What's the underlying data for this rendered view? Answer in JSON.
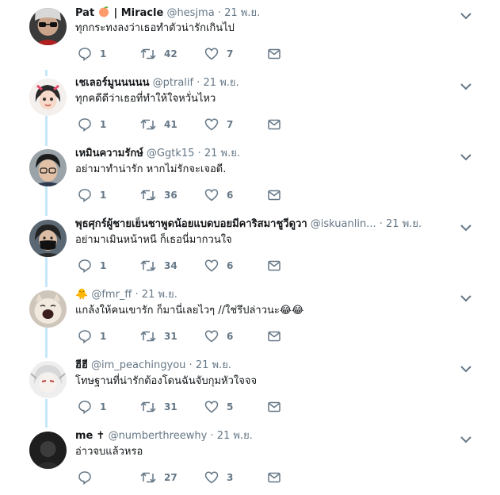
{
  "tweets": [
    {
      "name": "Pat",
      "name_extra": "| Miracle",
      "handle": "@hesjma",
      "dot": "·",
      "time": "21 พ.ย.",
      "text": "ทุกกระทงลงว่าเธอทำตัวน่ารักเกินไป",
      "replies": "1",
      "retweets": "42",
      "likes": "7",
      "avatar_icon": "avatar-sunglasses"
    },
    {
      "name": "เชเลอร์มูนนนนน",
      "handle": "@ptralif",
      "dot": "·",
      "time": "21 พ.ย.",
      "text": "ทุกคดีดีว่าเธอที่ทำให้ใจหวั่นไหว",
      "replies": "1",
      "retweets": "41",
      "likes": "7",
      "avatar_icon": "avatar-cartoon"
    },
    {
      "name": "เหมินความรักษ์",
      "handle": "@Ggtk15",
      "dot": "·",
      "time": "21 พ.ย.",
      "text": "อย่ามาทำน่ารัก หากไม่รักจะเจอดี.",
      "replies": "1",
      "retweets": "36",
      "likes": "6",
      "avatar_icon": "avatar-glasses"
    },
    {
      "name": "พุธศุกร์ผู้ชายเย็นชาพูดน้อยแบดบอยมีคาริสมาชูวีดูวา",
      "handle": "@iskuanlin...",
      "dot": "·",
      "time": "21 พ.ย.",
      "text": "อย่ามาเมินหน้าหนี ก็เธอนี่มากวนใจ",
      "replies": "1",
      "retweets": "34",
      "likes": "6",
      "avatar_icon": "avatar-mask"
    },
    {
      "name": "🐥",
      "handle": "@fmr_ff",
      "dot": "·",
      "time": "21 พ.ย.",
      "text": "แกล้งให้คนเขารัก ก็มานี่เลยไวๆ //ใช่รึปล่าวนะ",
      "emoji_tail": "😂😂",
      "replies": "1",
      "retweets": "31",
      "likes": "6",
      "avatar_icon": "avatar-cat"
    },
    {
      "name": "ฮีฮี",
      "handle": "@im_peachingyou",
      "dot": "·",
      "time": "21 พ.ย.",
      "text": "โทษฐานที่น่ารักต้องโดนฉันจับกุมหัวใจจจ",
      "replies": "1",
      "retweets": "31",
      "likes": "5",
      "avatar_icon": "avatar-anime"
    },
    {
      "name": "me",
      "name_extra": "✝",
      "handle": "@numberthreewhy",
      "dot": "·",
      "time": "21 พ.ย.",
      "text": "อ่าวจบแล้วหรอ",
      "replies": "",
      "retweets": "27",
      "likes": "3",
      "avatar_icon": "avatar-dark"
    }
  ],
  "colors": {
    "secondary": "#657786",
    "thread": "#c5e7fb",
    "text": "#14171a"
  }
}
